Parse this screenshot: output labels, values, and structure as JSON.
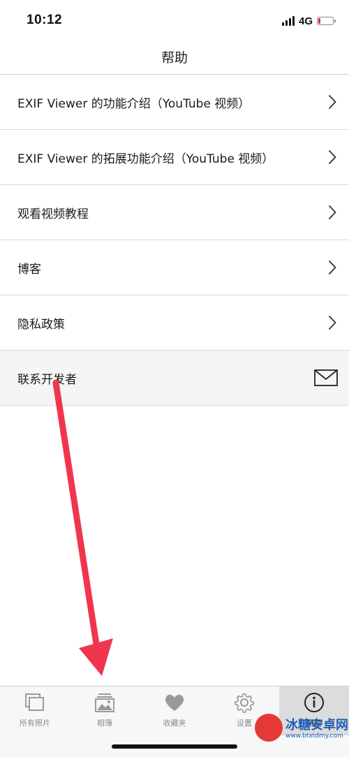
{
  "status_bar": {
    "time": "10:12",
    "network": "4G",
    "battery_level_percent": 15
  },
  "nav": {
    "title": "帮助"
  },
  "help_items": [
    {
      "label": "EXIF Viewer 的功能介绍（YouTube 视频）",
      "icon": "chevron-right-icon"
    },
    {
      "label": "EXIF Viewer 的拓展功能介绍（YouTube 视频）",
      "icon": "chevron-right-icon"
    },
    {
      "label": "观看视频教程",
      "icon": "chevron-right-icon"
    },
    {
      "label": "博客",
      "icon": "chevron-right-icon"
    },
    {
      "label": "隐私政策",
      "icon": "chevron-right-icon"
    },
    {
      "label": "联系开发者",
      "icon": "mail-icon"
    }
  ],
  "tab_bar": {
    "tabs": [
      {
        "label": "所有照片",
        "icon": "photos-stack-icon"
      },
      {
        "label": "相簿",
        "icon": "album-icon"
      },
      {
        "label": "收藏夹",
        "icon": "heart-icon"
      },
      {
        "label": "设置",
        "icon": "gear-icon"
      },
      {
        "label": "帮助",
        "icon": "info-icon",
        "active": true
      }
    ]
  },
  "annotation": {
    "color": "#f0364f"
  },
  "watermark": {
    "text": "冰糖安卓网",
    "url": "www.btxtdmy.com"
  }
}
